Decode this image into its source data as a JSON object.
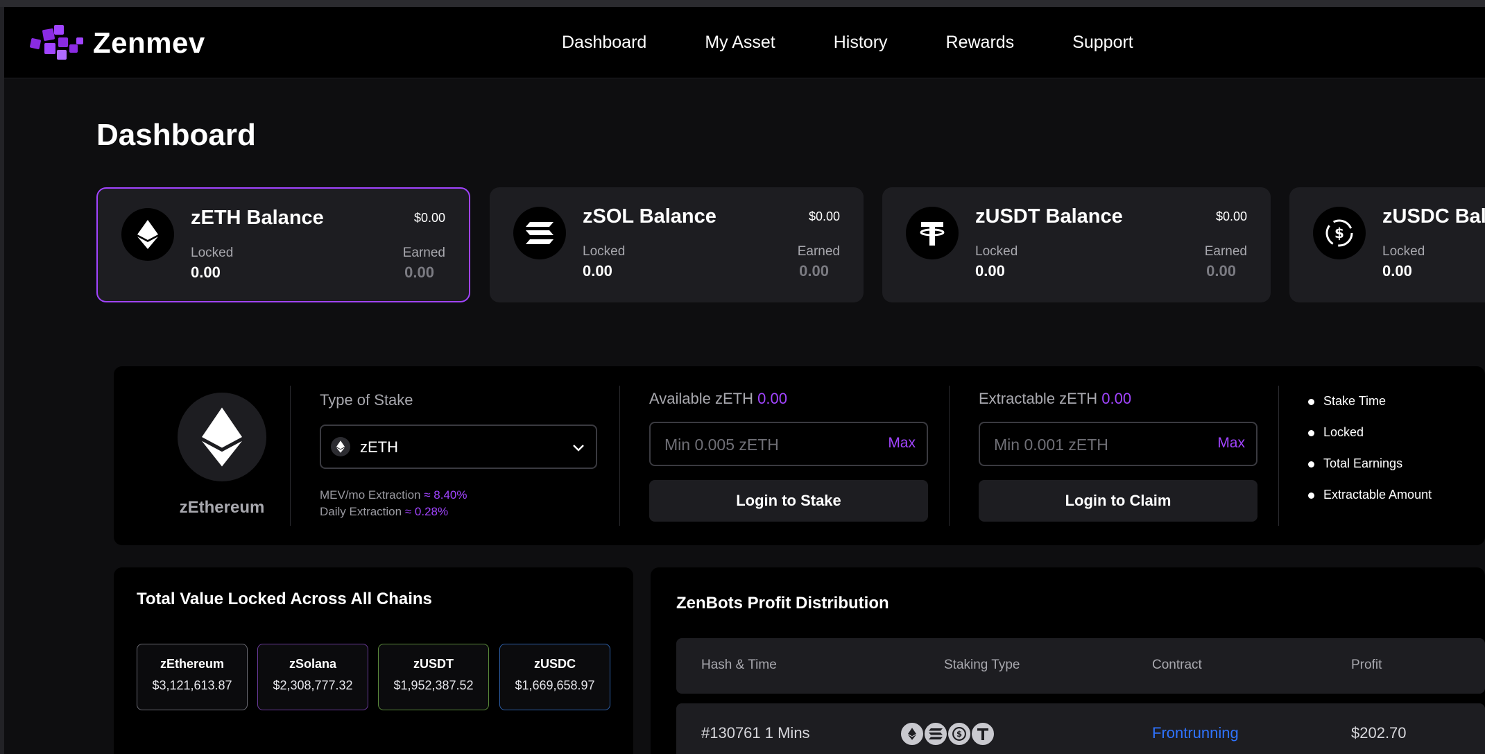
{
  "brand": {
    "name": "Zenmev"
  },
  "nav": {
    "items": [
      "Dashboard",
      "My Asset",
      "History",
      "Rewards",
      "Support"
    ]
  },
  "page": {
    "title": "Dashboard"
  },
  "balances": [
    {
      "name": "zETH Balance",
      "usd": "$0.00",
      "locked_label": "Locked",
      "locked": "0.00",
      "earned_label": "Earned",
      "earned": "0.00",
      "icon": "ethereum-icon"
    },
    {
      "name": "zSOL Balance",
      "usd": "$0.00",
      "locked_label": "Locked",
      "locked": "0.00",
      "earned_label": "Earned",
      "earned": "0.00",
      "icon": "solana-icon"
    },
    {
      "name": "zUSDT Balance",
      "usd": "$0.00",
      "locked_label": "Locked",
      "locked": "0.00",
      "earned_label": "Earned",
      "earned": "0.00",
      "icon": "tether-icon"
    },
    {
      "name": "zUSDC Bala",
      "locked_label": "Locked",
      "locked": "0.00",
      "icon": "usdc-icon"
    }
  ],
  "stake": {
    "asset_name": "zEthereum",
    "type_label": "Type of Stake",
    "selected": "zETH",
    "mev_label": "MEV/mo Extraction",
    "mev_value": "≈ 8.40%",
    "daily_label": "Daily Extraction",
    "daily_value": "≈ 0.28%",
    "available_label": "Available zETH",
    "available_value": "0.00",
    "stake_placeholder": "Min 0.005 zETH",
    "max_label": "Max",
    "stake_button": "Login to Stake",
    "extractable_label": "Extractable zETH",
    "extractable_value": "0.00",
    "claim_placeholder": "Min 0.001 zETH",
    "claim_button": "Login to Claim",
    "info": [
      "Stake Time",
      "Locked",
      "Total Earnings",
      "Extractable Amount"
    ]
  },
  "tvl": {
    "title": "Total Value Locked Across All Chains",
    "chips": [
      {
        "name": "zEthereum",
        "value": "$3,121,613.87",
        "color": "#6b6b73"
      },
      {
        "name": "zSolana",
        "value": "$2,308,777.32",
        "color": "#6a3a9a"
      },
      {
        "name": "zUSDT",
        "value": "$1,952,387.52",
        "color": "#5a8a3a"
      },
      {
        "name": "zUSDC",
        "value": "$1,669,658.97",
        "color": "#2d5fa8"
      }
    ]
  },
  "profit": {
    "title": "ZenBots Profit Distribution",
    "headers": [
      "Hash & Time",
      "Staking Type",
      "Contract",
      "Profit"
    ],
    "rows": [
      {
        "hash_time": "#130761 1 Mins",
        "contract": "Frontrunning",
        "profit": "$202.70"
      }
    ]
  },
  "colors": {
    "accent": "#a144ff",
    "link": "#2f73ff",
    "card": "#1d1d21"
  }
}
